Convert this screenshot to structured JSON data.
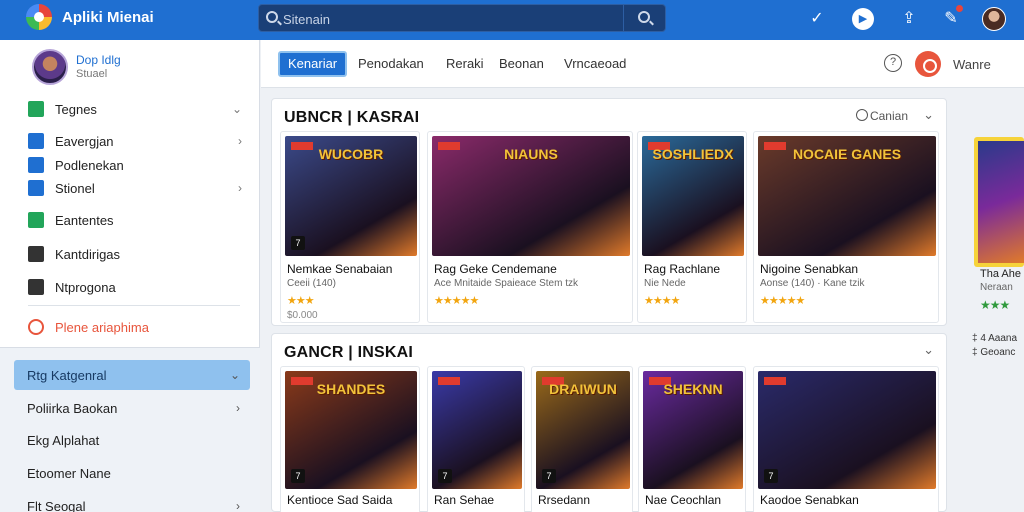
{
  "app": {
    "title": "Apliki Mienai"
  },
  "search": {
    "placeholder": "Sitenain"
  },
  "profile": {
    "name": "Dop Idlg",
    "subtitle": "Stuael"
  },
  "sidebar": {
    "items": [
      {
        "label": "Tegnes",
        "icon": "gamepad-icon",
        "color": "#22a55a",
        "chevron": "down"
      },
      {
        "label": "Eavergjan",
        "icon": "chart-icon",
        "color": "#1f6fd1",
        "chevron": "right"
      },
      {
        "label": "Podlenekan",
        "icon": "cloud-icon",
        "color": "#1f6fd1",
        "chevron": ""
      },
      {
        "label": "Stionel",
        "icon": "grid-icon",
        "color": "#1f6fd1",
        "chevron": "right"
      },
      {
        "label": "Eantentes",
        "icon": "list-icon",
        "color": "#22a55a",
        "chevron": ""
      },
      {
        "label": "Kantdirigas",
        "icon": "plus-box-icon",
        "color": "#333333",
        "chevron": ""
      },
      {
        "label": "Ntprogona",
        "icon": "home-icon",
        "color": "#333333",
        "chevron": ""
      }
    ],
    "highlight": {
      "label": "Plene ariaphima",
      "color": "#e8553c"
    },
    "categories": [
      {
        "label": "Rtg Katgenral",
        "active": true,
        "chevron": "down"
      },
      {
        "label": "Poliirka Baokan",
        "active": false,
        "chevron": "right"
      },
      {
        "label": "Ekg Alplahat",
        "active": false,
        "chevron": ""
      },
      {
        "label": "Etoomer Nane",
        "active": false,
        "chevron": ""
      },
      {
        "label": "Flt Seogal",
        "active": false,
        "chevron": "right"
      }
    ]
  },
  "tabs": [
    "Kenariar",
    "Penodakan",
    "Reraki",
    "Beonan",
    "Vrncaeoad"
  ],
  "tab_right": "Wanre",
  "section1": {
    "title": "UBNCR | KASRAI",
    "sort_label": "Canian",
    "cards": [
      {
        "name": "Nemkae Senabaian",
        "meta": "Ceeii",
        "meta2": "(140)",
        "stars": "★★★",
        "price": "$0.000",
        "art": "WUCOBR",
        "badge": "7",
        "bg": "#3b4a8a"
      },
      {
        "name": "Rag Geke Cendemane",
        "meta": "Ace Mnitaide Spaieace",
        "meta2": "Stem tzk",
        "stars": "★★★★★",
        "price": "",
        "art": "NIAUNS",
        "badge": "",
        "bg": "#8a2a6a"
      },
      {
        "name": "Rag Rachlane",
        "meta": "Nie Nede",
        "meta2": "",
        "stars": "★★★★",
        "price": "",
        "art": "SOSHLIEDX",
        "badge": "",
        "bg": "#2a6a9a"
      },
      {
        "name": "Nigoine Senabkan",
        "meta": "Aonse",
        "meta2": "(140) · Kane tzik",
        "stars": "★★★★★",
        "price": "",
        "art": "NOCAIE GANES",
        "badge": "",
        "bg": "#6a3a2a"
      }
    ]
  },
  "section2": {
    "title": "GANCR | INSKAI",
    "cards": [
      {
        "name": "Kentioce Sad Saida",
        "art": "SHANDES",
        "badge": "7",
        "bg": "#8a3a1a"
      },
      {
        "name": "Ran Sehae",
        "art": "",
        "badge": "7",
        "bg": "#3a3aa8"
      },
      {
        "name": "Rrsedann",
        "art": "DRAIWUN",
        "badge": "7",
        "bg": "#9a6a1a"
      },
      {
        "name": "Nae Ceochlan",
        "art": "SHEKNN",
        "badge": "",
        "bg": "#6a2aa0"
      },
      {
        "name": "Kaodoe Senabkan",
        "art": "",
        "badge": "7",
        "bg": "#2a2a6a"
      }
    ]
  },
  "peek": {
    "name": "Tha Ahe",
    "sub": "Neraan",
    "stars": "★★★",
    "foot1": "‡ 4 Aaana",
    "foot2": "‡ Geoanc"
  }
}
